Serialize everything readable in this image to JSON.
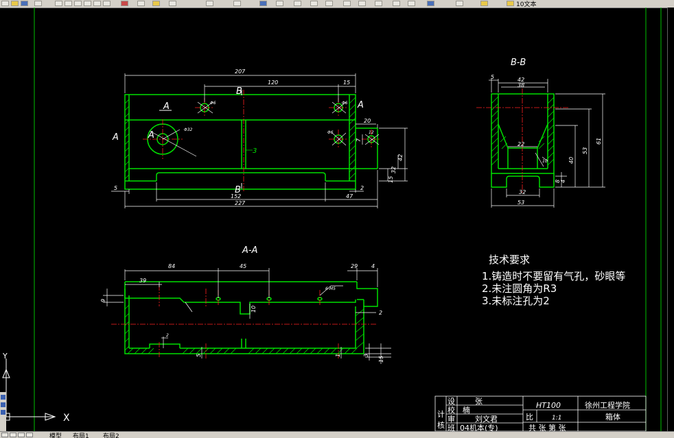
{
  "toolbar": {
    "layer_name": "10文本"
  },
  "tabs": {
    "model": "模型",
    "layout1": "布局1",
    "layout2": "布局2"
  },
  "ucs": {
    "x_label": "X",
    "y_label": "Y"
  },
  "drawing": {
    "top_view": {
      "title_b": "B",
      "label_a": "A",
      "dims": {
        "d207": "207",
        "d120": "120",
        "d15": "15",
        "d20": "20",
        "d5": "5",
        "d152": "152",
        "d227": "227",
        "d47": "47",
        "d2": "2",
        "d3": "3",
        "d32": "32",
        "d42": "42",
        "d15v": "15",
        "d7": "7",
        "d12": "12",
        "dh1": "Φ6",
        "dh2": "Φ6",
        "dh3": "Φ6",
        "dh4": "Φ32"
      }
    },
    "bb_view": {
      "title": "B-B",
      "dims": {
        "d5": "5",
        "d42": "42",
        "d38": "38",
        "d22": "22",
        "d32": "32",
        "d53": "53",
        "d61": "61",
        "d53v": "53",
        "d40": "40",
        "d8": "8",
        "d4": "4",
        "d10": "10"
      }
    },
    "aa_view": {
      "title": "A-A",
      "dims": {
        "d84": "84",
        "d45": "45",
        "d29": "29",
        "d4": "4",
        "d39": "39",
        "d9": "9",
        "d6m5": "6-M5",
        "d10": "10",
        "d2": "2",
        "d2b": "2",
        "d5": "5",
        "d1": "1",
        "d3": "3",
        "d15": "15"
      }
    },
    "notes": {
      "heading": "技术要求",
      "line1": "1.铸造时不要留有气孔，砂眼等",
      "line2": "2.未注圆角为R3",
      "line3": "3.未标注孔为2"
    },
    "title_block": {
      "design": "设",
      "check": "校",
      "approve": "审",
      "class": "班",
      "zhang1": "张",
      "zhang2": "楠",
      "name": "刘文君",
      "class_name": "04机本(专)",
      "material": "HT100",
      "school": "徐州工程学院",
      "ratio_label": "比",
      "ratio": "1:1",
      "part_name": "箱体",
      "sheet_total": "共 张 第 张",
      "ji": "计",
      "he": "核"
    }
  },
  "colors": {
    "outline": "#00e000",
    "dim": "#ffffff",
    "center": "#ff2020",
    "border": "#00c000",
    "background": "#000000"
  }
}
